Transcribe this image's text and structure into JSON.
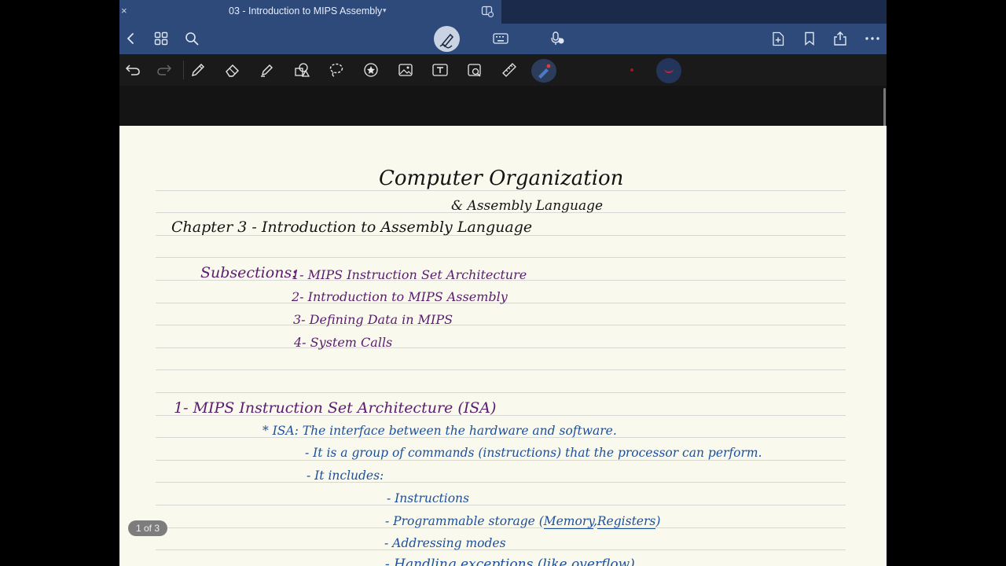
{
  "window": {
    "tab_title": "03 - Introduction to MIPS Assembly",
    "close_glyph": "×"
  },
  "toolbar": {
    "icons": [
      "undo-icon",
      "redo-icon",
      "pen-icon",
      "eraser-icon",
      "highlighter-icon",
      "shapes-icon",
      "lasso-icon",
      "sticker-icon",
      "image-icon",
      "text-box-icon",
      "camera-icon",
      "ruler-icon",
      "laser-pointer-icon"
    ],
    "active_color": "#c8282a",
    "secondary_color": "#9a1b1b"
  },
  "note": {
    "title_line1": "Computer Organization",
    "title_line2": "& Assembly Language",
    "chapter": "Chapter 3 - Introduction to Assembly Language",
    "subsections_label": "Subsections:",
    "subsections": [
      "1- MIPS Instruction Set Architecture",
      "2- Introduction to MIPS Assembly",
      "3- Defining Data in MIPS",
      "4- System Calls"
    ],
    "section1_heading": "1- MIPS Instruction Set Architecture (ISA)",
    "isa_line": "* ISA: The interface between the hardware and software.",
    "it_line1": "- It is a group of commands (instructions) that the processor can perform.",
    "it_line2": "- It includes:",
    "includes": {
      "item1": "- Instructions",
      "item2_prefix": "- Programmable storage (",
      "item2_memory": "Memory",
      "item2_sep": ",",
      "item2_registers": "Registers",
      "item2_suffix": ")",
      "item3": "- Addressing modes",
      "item4": "- Handling exceptions (like overflow)"
    }
  },
  "pager": {
    "label": "1 of 3"
  },
  "colors": {
    "nav_bar": "#2d4a7a",
    "paper": "#f9f9ee",
    "ink_black": "#141414",
    "ink_purple": "#5a1c6e",
    "ink_blue": "#1c4f9c"
  }
}
